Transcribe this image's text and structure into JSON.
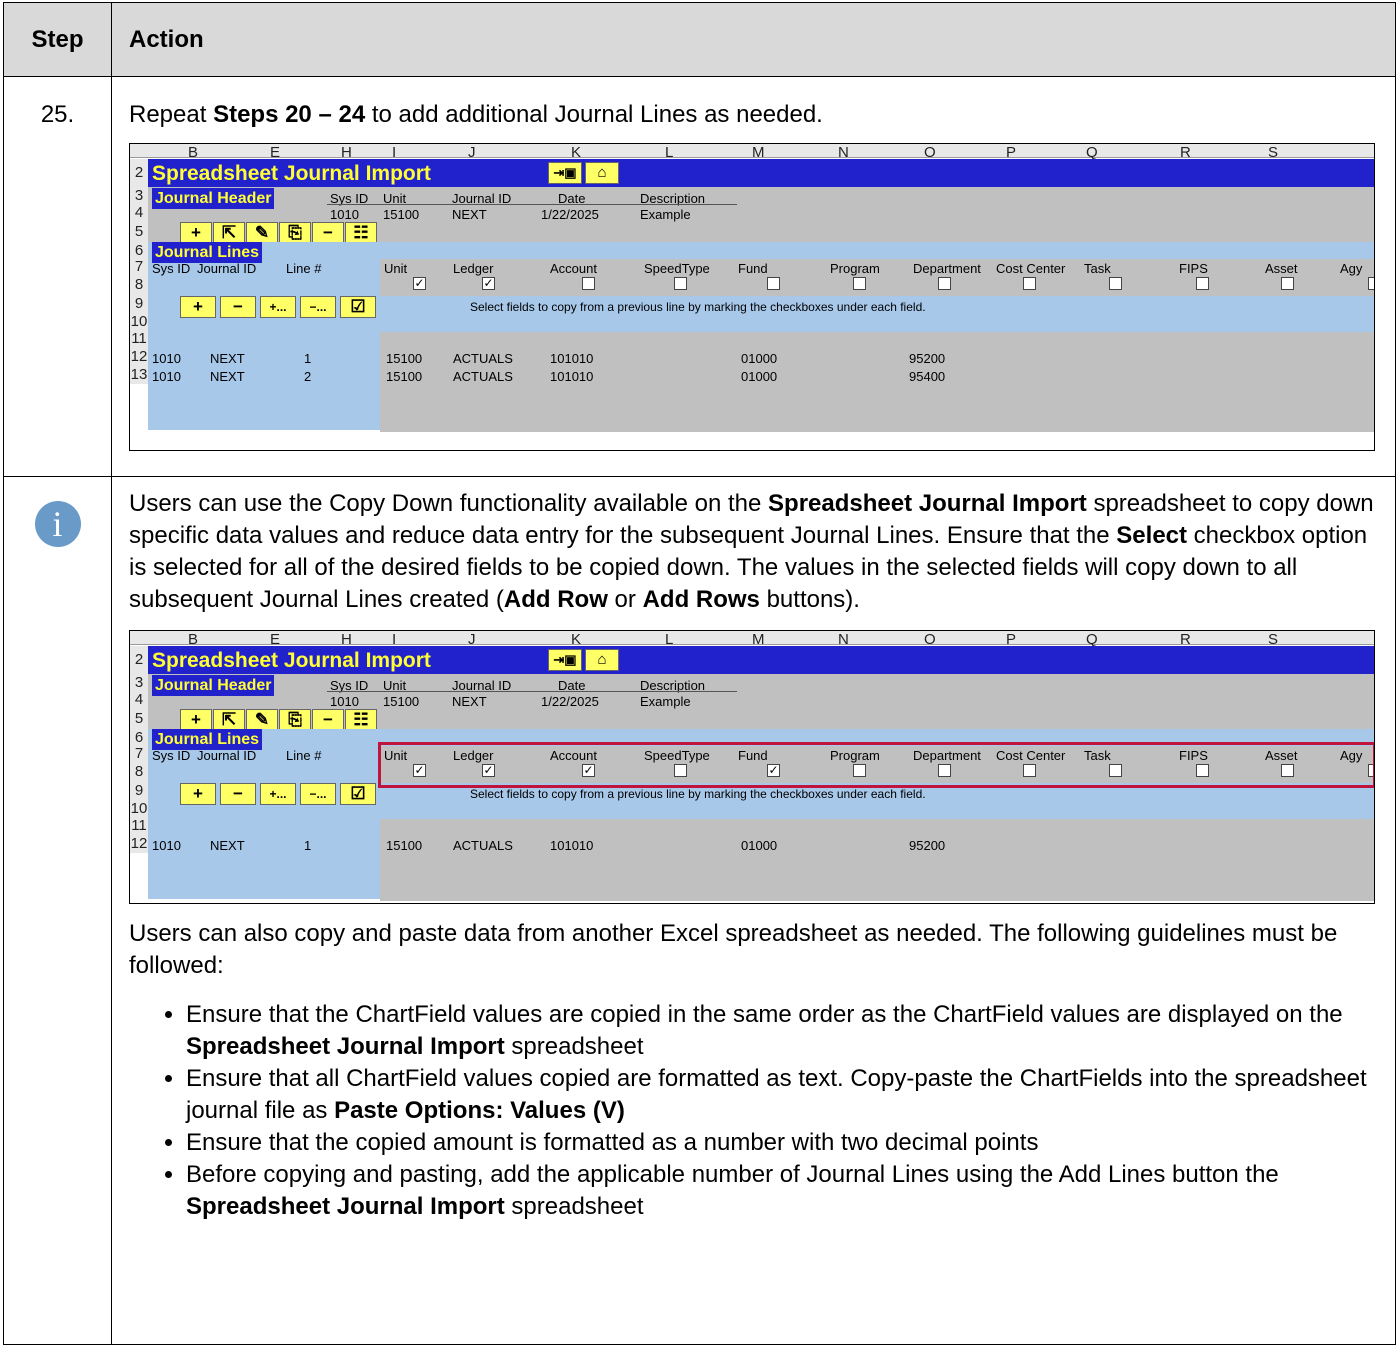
{
  "header": {
    "step": "Step",
    "action": "Action"
  },
  "step25": {
    "number": "25.",
    "text_prefix": "Repeat ",
    "text_bold": "Steps 20 – 24",
    "text_suffix": " to add additional Journal Lines as needed."
  },
  "spreadsheet": {
    "columns": [
      "B",
      "E",
      "H",
      "I",
      "J",
      "K",
      "L",
      "M",
      "N",
      "O",
      "P",
      "Q",
      "R",
      "S"
    ],
    "rows": [
      "2",
      "3",
      "4",
      "5",
      "6",
      "7",
      "8",
      "9",
      "10",
      "11",
      "12",
      "13"
    ],
    "title": "Spreadsheet Journal Import",
    "journal_header": "Journal Header",
    "header_fields": [
      "Sys ID",
      "Unit",
      "Journal ID",
      "Date",
      "Description"
    ],
    "header_values": [
      "1010",
      "15100",
      "NEXT",
      "1/22/2025",
      "Example"
    ],
    "journal_lines": "Journal Lines",
    "line_fields": [
      "Sys ID",
      "Journal ID",
      "Line #",
      "Unit",
      "Ledger",
      "Account",
      "SpeedType",
      "Fund",
      "Program",
      "Department",
      "Cost Center",
      "Task",
      "FIPS",
      "Asset",
      "Agy"
    ],
    "copy_hint": "Select fields to copy from a previous line by marking the checkboxes under each field.",
    "row12": [
      "1010",
      "NEXT",
      "1",
      "15100",
      "ACTUALS",
      "101010",
      "01000",
      "95200"
    ],
    "row13": [
      "1010",
      "NEXT",
      "2",
      "15100",
      "ACTUALS",
      "101010",
      "01000",
      "95400"
    ]
  },
  "note": {
    "p1_a": "Users can use the Copy Down functionality available on the ",
    "p1_b": "Spreadsheet Journal Import",
    "p1_c": " spreadsheet to copy down specific data values and reduce data entry for the subsequent Journal Lines. Ensure that the ",
    "p1_d": "Select",
    "p1_e": " checkbox option is selected for all of the desired fields to be copied down. The values in the selected fields will copy down to all subsequent Journal Lines created (",
    "p1_f": "Add Row",
    "p1_g": " or ",
    "p1_h": "Add Rows",
    "p1_i": " buttons).",
    "p2": "Users can also copy and paste data from another Excel spreadsheet as needed. The following guidelines must be followed:",
    "b1_a": "Ensure that the ChartField values are copied in the same order as the ChartField values are displayed on the ",
    "b1_b": "Spreadsheet Journal Import",
    "b1_c": " spreadsheet",
    "b2_a": "Ensure that all ChartField values copied are formatted as text. Copy-paste the ChartFields into the spreadsheet journal file as ",
    "b2_b": "Paste Options: Values (V)",
    "b3": "Ensure that the copied amount is formatted as a number with two decimal points",
    "b4_a": "Before copying and pasting, add the applicable number of Journal Lines using the Add Lines button the ",
    "b4_b": "Spreadsheet Journal Import",
    "b4_c": " spreadsheet"
  }
}
